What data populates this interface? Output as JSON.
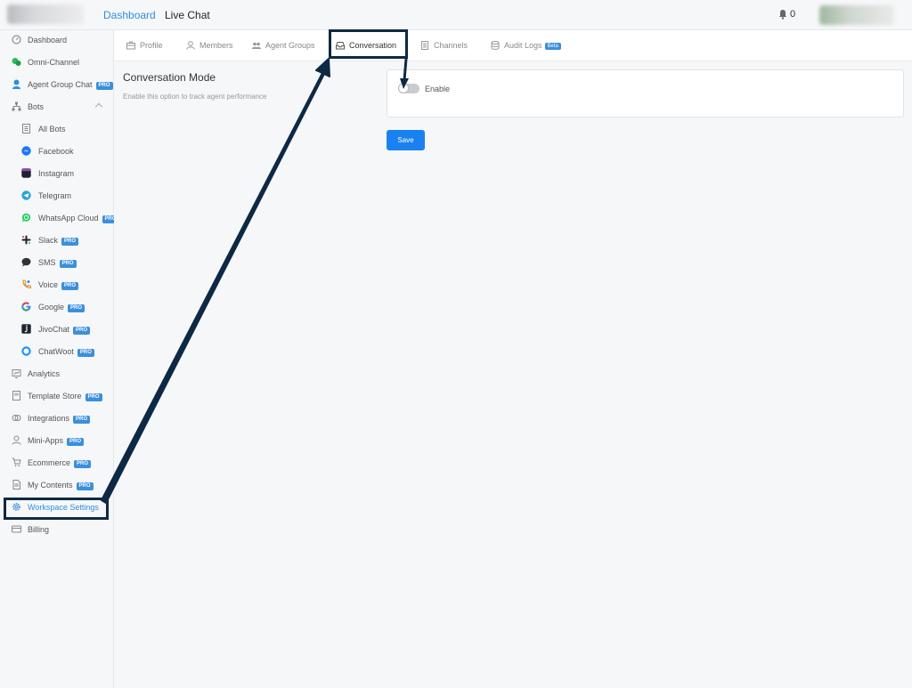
{
  "topbar": {
    "nav": [
      {
        "label": "Dashboard",
        "active": true
      },
      {
        "label": "Live Chat",
        "active": false
      }
    ],
    "notifications_count": "0",
    "accent_color": "#2d8fe0"
  },
  "sidebar": {
    "items": [
      {
        "label": "Dashboard",
        "icon": "dashboard-icon",
        "pro": false
      },
      {
        "label": "Omni-Channel",
        "icon": "omni-channel-icon",
        "pro": false
      },
      {
        "label": "Agent Group Chat",
        "icon": "agent-group-chat-icon",
        "pro": true
      },
      {
        "label": "Bots",
        "icon": "bots-icon",
        "pro": false,
        "expanded": true
      },
      {
        "label": "All Bots",
        "icon": "all-bots-icon",
        "pro": false
      },
      {
        "label": "Facebook",
        "icon": "facebook-messenger-icon",
        "pro": false
      },
      {
        "label": "Instagram",
        "icon": "instagram-icon",
        "pro": false
      },
      {
        "label": "Telegram",
        "icon": "telegram-icon",
        "pro": false
      },
      {
        "label": "WhatsApp Cloud",
        "icon": "whatsapp-icon",
        "pro": true
      },
      {
        "label": "Slack",
        "icon": "slack-icon",
        "pro": true
      },
      {
        "label": "SMS",
        "icon": "sms-icon",
        "pro": true
      },
      {
        "label": "Voice",
        "icon": "voice-icon",
        "pro": true
      },
      {
        "label": "Google",
        "icon": "google-icon",
        "pro": true
      },
      {
        "label": "JivoChat",
        "icon": "jivochat-icon",
        "pro": true
      },
      {
        "label": "ChatWoot",
        "icon": "chatwoot-icon",
        "pro": true
      },
      {
        "label": "Analytics",
        "icon": "analytics-icon",
        "pro": false
      },
      {
        "label": "Template Store",
        "icon": "template-store-icon",
        "pro": true
      },
      {
        "label": "Integrations",
        "icon": "integrations-icon",
        "pro": true
      },
      {
        "label": "Mini-Apps",
        "icon": "mini-apps-icon",
        "pro": true
      },
      {
        "label": "Ecommerce",
        "icon": "ecommerce-icon",
        "pro": true
      },
      {
        "label": "My Contents",
        "icon": "my-contents-icon",
        "pro": true
      },
      {
        "label": "Workspace Settings",
        "icon": "gear-icon",
        "pro": false,
        "active": true
      },
      {
        "label": "Billing",
        "icon": "billing-icon",
        "pro": false
      }
    ],
    "pro_badge": "PRO"
  },
  "tabs": [
    {
      "label": "Profile",
      "icon": "briefcase-icon"
    },
    {
      "label": "Members",
      "icon": "user-icon"
    },
    {
      "label": "Agent Groups",
      "icon": "users-icon"
    },
    {
      "label": "Conversation",
      "icon": "inbox-icon",
      "active": true
    },
    {
      "label": "Channels",
      "icon": "document-icon"
    },
    {
      "label": "Audit Logs",
      "icon": "database-icon",
      "badge": "Beta"
    }
  ],
  "conversation_mode": {
    "title": "Conversation Mode",
    "description": "Enable this option to track agent performance",
    "toggle_label": "Enable",
    "toggle_on": false,
    "save_label": "Save",
    "save_color": "#1a82f0"
  },
  "annotation_color": "#0d2944"
}
